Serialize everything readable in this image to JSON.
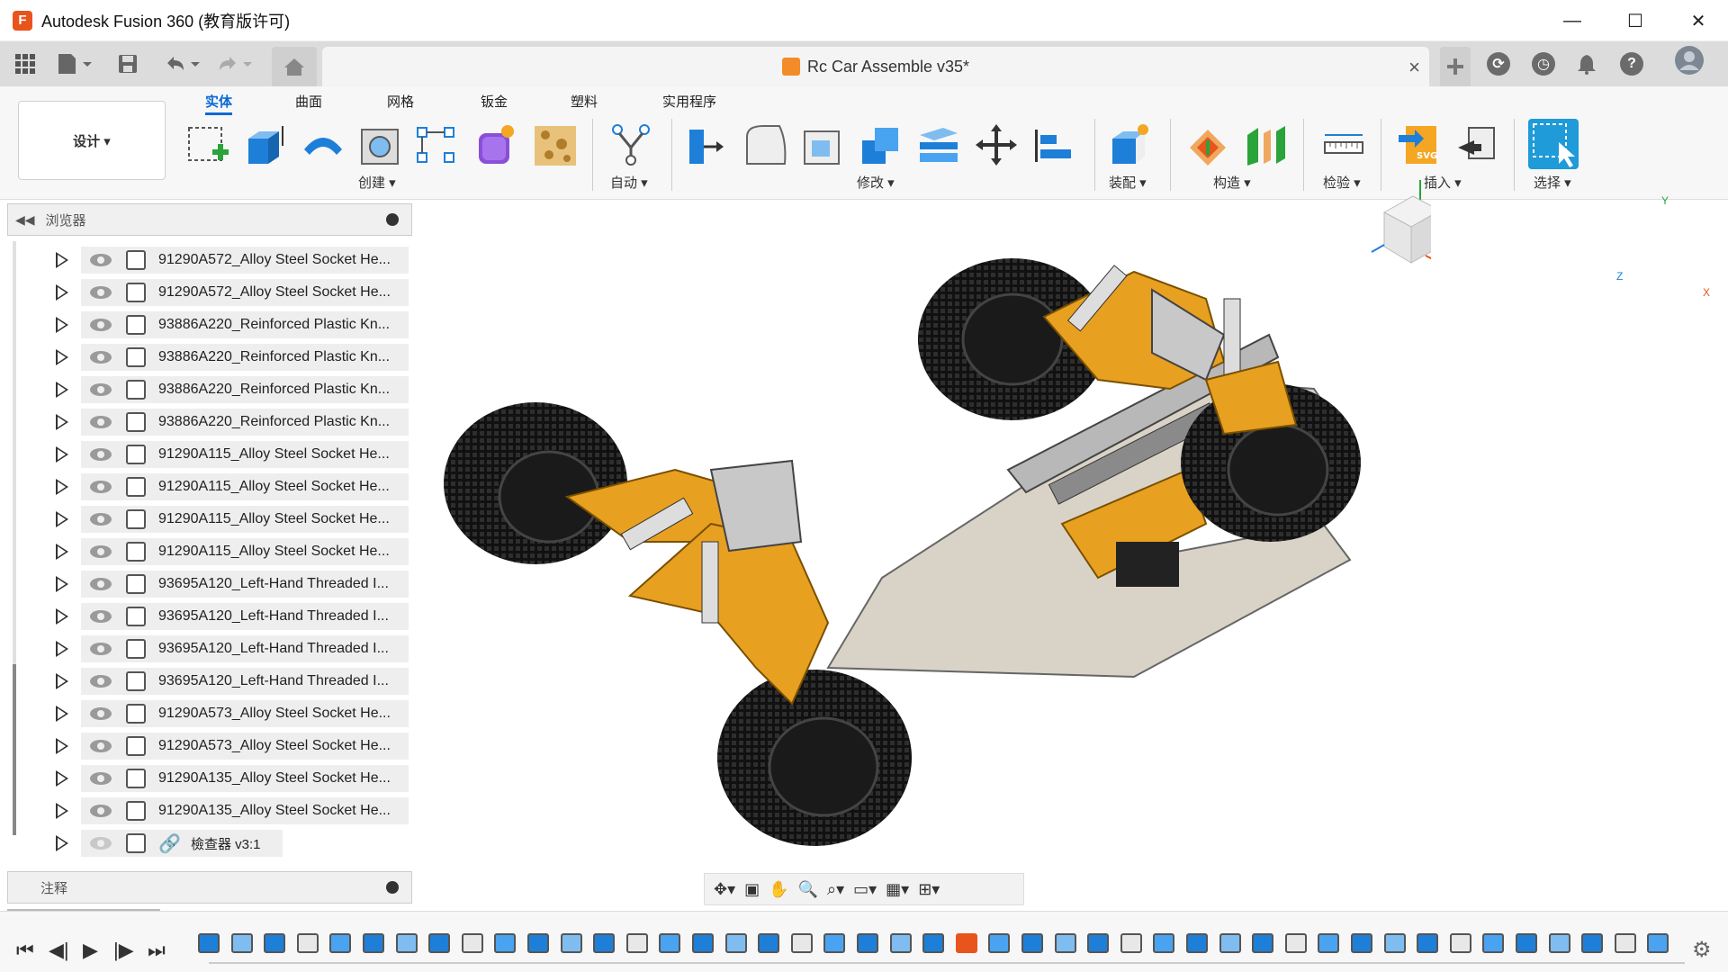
{
  "window": {
    "title": "Autodesk Fusion 360 (教育版许可)",
    "logo": "F",
    "minimize": "—",
    "maximize": "☐",
    "close": "✕"
  },
  "document": {
    "title": "Rc Car Assemble v35*",
    "close": "×"
  },
  "ribbon": {
    "tabs": [
      "实体",
      "曲面",
      "网格",
      "钣金",
      "塑料",
      "实用程序"
    ],
    "workspace": "设计 ▾",
    "groups": {
      "create": "创建 ▾",
      "automate": "自动 ▾",
      "modify": "修改 ▾",
      "assemble": "装配 ▾",
      "construct": "构造 ▾",
      "inspect": "检验 ▾",
      "insert": "插入 ▾",
      "select": "选择 ▾"
    }
  },
  "browser": {
    "title": "浏览器",
    "items": [
      "91290A572_Alloy Steel Socket He...",
      "91290A572_Alloy Steel Socket He...",
      "93886A220_Reinforced Plastic Kn...",
      "93886A220_Reinforced Plastic Kn...",
      "93886A220_Reinforced Plastic Kn...",
      "93886A220_Reinforced Plastic Kn...",
      "91290A115_Alloy Steel Socket He...",
      "91290A115_Alloy Steel Socket He...",
      "91290A115_Alloy Steel Socket He...",
      "91290A115_Alloy Steel Socket He...",
      "93695A120_Left-Hand Threaded I...",
      "93695A120_Left-Hand Threaded I...",
      "93695A120_Left-Hand Threaded I...",
      "93695A120_Left-Hand Threaded I...",
      "91290A573_Alloy Steel Socket He...",
      "91290A573_Alloy Steel Socket He...",
      "91290A135_Alloy Steel Socket He...",
      "91290A135_Alloy Steel Socket He..."
    ],
    "linked_item": "檢查器 v3:1",
    "notes": "注释"
  },
  "viewcube": {
    "axis_y": "Y",
    "axis_z": "Z",
    "axis_x": "X"
  },
  "colors": {
    "accent": "#0a6ad6",
    "chassis_gold": "#e8a020",
    "tire": "#1a1a1a",
    "plate": "#d8d0c0"
  }
}
